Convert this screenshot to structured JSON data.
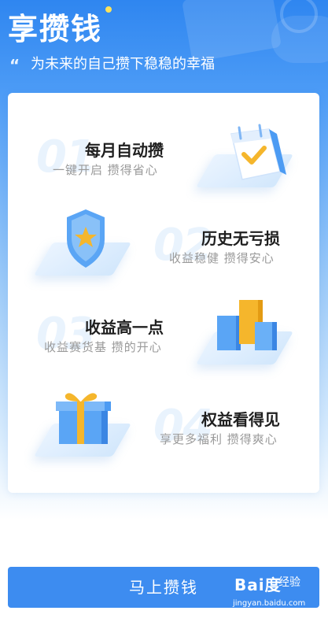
{
  "header": {
    "title": "享攒钱",
    "subtitle": "为未来的自己攒下稳稳的幸福",
    "quote_mark": "“"
  },
  "features": [
    {
      "number": "01",
      "title": "每月自动攒",
      "subtitle": "一键开启  攒得省心",
      "icon": "calendar-check-icon"
    },
    {
      "number": "02",
      "title": "历史无亏损",
      "subtitle": "收益稳健  攒得安心",
      "icon": "shield-star-icon"
    },
    {
      "number": "03",
      "title": "收益高一点",
      "subtitle": "收益赛货基 攒的开心",
      "icon": "bar-chart-icon"
    },
    {
      "number": "04",
      "title": "权益看得见",
      "subtitle": "享更多福利 攒得爽心",
      "icon": "gift-box-icon"
    }
  ],
  "cta": {
    "label": "马上攒钱"
  },
  "watermark": {
    "brand": "Bai度",
    "product": "经验",
    "url": "jingyan.baidu.com"
  },
  "colors": {
    "accent": "#3d8cf0",
    "header_blue": "#2f86f0",
    "gold": "#f5b62c",
    "title_text": "#1f1f1f",
    "sub_text": "#9a9a9a"
  }
}
